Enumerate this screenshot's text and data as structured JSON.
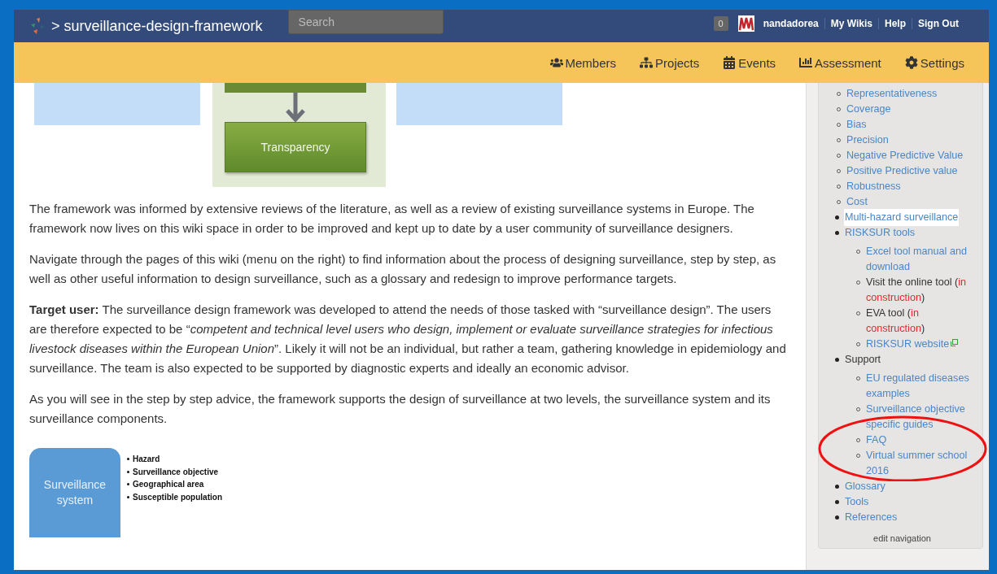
{
  "header": {
    "project": "> surveillance-design-framework",
    "search": {
      "placeholder": "Search"
    },
    "notifications": "0",
    "user_links": [
      "nandadorea",
      "My Wikis",
      "Help",
      "Sign Out"
    ]
  },
  "nav": [
    {
      "label": "Members"
    },
    {
      "label": "Projects"
    },
    {
      "label": "Events"
    },
    {
      "label": "Assessment"
    },
    {
      "label": "Settings"
    }
  ],
  "diagram": {
    "node": "Transparency"
  },
  "paragraphs": [
    "The framework was informed by extensive reviews of the literature, as well as a review of existing surveillance systems in Europe. The framework now lives on this wiki space in order to be improved and kept up to date by a user community of surveillance designers.",
    "Navigate through the pages of this wiki (menu on the right) to find information about the process of designing surveillance, step by step, as well as other useful information to design surveillance, such as a glossary and redesign to improve performance targets.",
    "**Target user:** The surveillance design framework was developed to attend the needs of those tasked with “surveillance design”. The users are therefore expected to be “*competent and technical level users who design, implement or evaluate surveillance strategies for infectious livestock diseases within the European Union*”. Likely it will not be an individual, but rather a team, gathering knowledge in epidemiology and surveillance. The team is also expected to be supported by diagnostic experts and ideally an economic advisor.",
    "As you will see in the step by step advice, the framework supports the design of surveillance at two levels, the surveillance system and its surveillance components."
  ],
  "figure": {
    "box": "Surveillance system",
    "bullets": [
      "Hazard",
      "Surveillance objective",
      "Geographical area",
      "Susceptible population"
    ]
  },
  "sidebar": {
    "items": [
      {
        "kind": "group",
        "children": [
          {
            "kind": "link",
            "label": "Representativeness",
            "selected": false
          },
          {
            "kind": "link",
            "label": "Coverage",
            "selected": false
          },
          {
            "kind": "link",
            "label": "Bias",
            "selected": false
          },
          {
            "kind": "link",
            "label": "Precision",
            "selected": false
          },
          {
            "kind": "link",
            "label": "Negative Predictive Value",
            "selected": false
          },
          {
            "kind": "link",
            "label": "Positive Predictive value",
            "selected": false
          },
          {
            "kind": "link",
            "label": "Robustness",
            "selected": false
          },
          {
            "kind": "link",
            "label": "Cost",
            "selected": false
          }
        ]
      },
      {
        "kind": "link",
        "label": "Multi-hazard surveillance",
        "selected": true
      },
      {
        "kind": "link",
        "label": "RISKSUR tools",
        "selected": false,
        "children": [
          {
            "kind": "link",
            "label": "Excel tool manual and download",
            "selected": false
          },
          {
            "kind": "mixed",
            "selected": false,
            "parts": [
              {
                "text": "Visit the online tool (",
                "kind": "plain"
              },
              {
                "text": "in construction",
                "kind": "alert"
              },
              {
                "text": ")",
                "kind": "plain"
              }
            ]
          },
          {
            "kind": "mixed",
            "selected": false,
            "parts": [
              {
                "text": "EVA tool (",
                "kind": "plain"
              },
              {
                "text": "in construction",
                "kind": "alert"
              },
              {
                "text": ")",
                "kind": "plain"
              }
            ]
          },
          {
            "kind": "external",
            "label": "RISKSUR website",
            "selected": false
          }
        ]
      },
      {
        "kind": "text",
        "label": "Support",
        "selected": false,
        "children": [
          {
            "kind": "link",
            "label": "EU regulated diseases examples",
            "selected": false
          },
          {
            "kind": "link",
            "label": "Surveillance objective specific guides",
            "selected": false
          },
          {
            "kind": "link",
            "label": "FAQ",
            "selected": false
          },
          {
            "kind": "link",
            "label": "Virtual summer school 2016",
            "selected": false
          }
        ]
      },
      {
        "kind": "link",
        "label": "Glossary",
        "selected": false
      },
      {
        "kind": "link",
        "label": "Tools",
        "selected": false
      },
      {
        "kind": "link",
        "label": "References",
        "selected": false
      }
    ],
    "edit_link": "edit navigation"
  }
}
